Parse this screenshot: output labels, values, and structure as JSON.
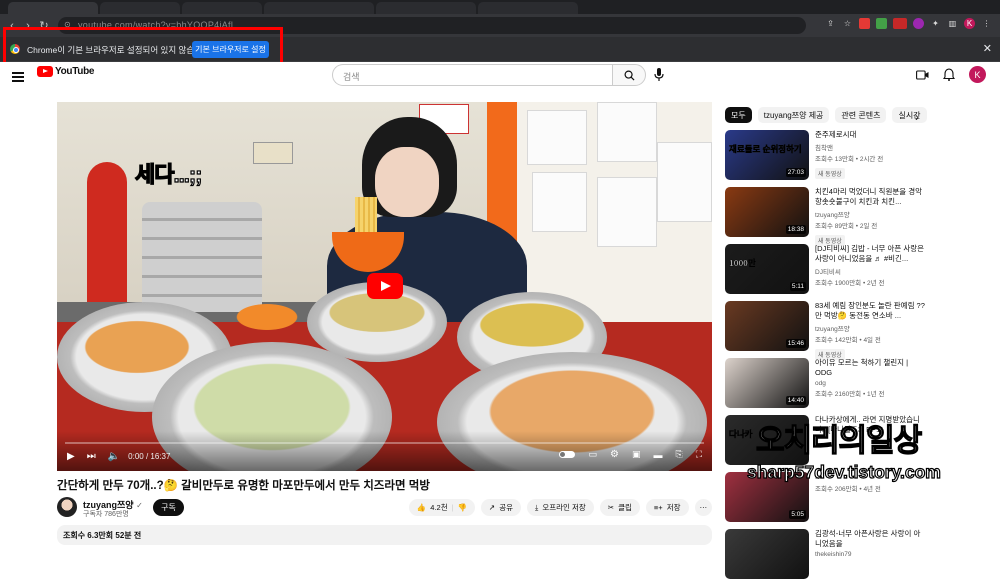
{
  "browser": {
    "url_text": "youtube.com/watch?v=bhYOQP4iAfl",
    "nav_icons": [
      "back-icon",
      "forward-icon",
      "reload-icon"
    ],
    "extension_icons": [
      "puzzle-icon",
      "sidebar-icon"
    ],
    "profile_initial": "K"
  },
  "infobar": {
    "message": "Chrome이 기본 브라우저로 설정되어 있지 않습니다",
    "button_label": "기본 브라우저로 설정",
    "close_glyph": "✕"
  },
  "youtube": {
    "logo_text": "YouTube",
    "search_placeholder": "검색",
    "avatar_initial": "K"
  },
  "player": {
    "overlay_caption": "세다...;;",
    "time_text": "0:00 / 16:37",
    "progress_fraction": 0.0
  },
  "video": {
    "title": "간단하게 만두 70개..?🤔 갈비만두로 유명한 마포만두에서 만두 치즈라면 먹방",
    "channel_name": "tzuyang쯔양",
    "subscribers": "구독자 786만명",
    "subscribe_label": "구독",
    "like_count": "4.2천",
    "share_label": "공유",
    "download_label": "오프라인 저장",
    "clip_label": "클립",
    "save_label": "저장",
    "more_glyph": "⋯",
    "description_stats": "조회수 6.3만회  52분 전"
  },
  "chips": [
    "모두",
    "tzuyang쯔양 제공",
    "관련 콘텐츠",
    "실시간"
  ],
  "recommendations": [
    {
      "title": "준주제로시대",
      "channel": "침착맨",
      "meta": "조회수 13만회 • 2시간 전",
      "badge": "새 동영상",
      "duration": "27:03",
      "thumb_color": "#2a3a8a",
      "thumb_text": "재료들로 순위정하기"
    },
    {
      "title": "치킨4마리 먹었더니 직원분을 경악 항솟숏불구이 치킨과 치킨...",
      "channel": "tzuyang쯔양",
      "meta": "조회수 89만회 • 2일 전",
      "badge": "새 동영상",
      "duration": "18:38",
      "thumb_color": "#8a3a12",
      "thumb_text": ""
    },
    {
      "title": "[DJ티비씨] 김밥 - 너무 아픈 사랑은 사랑이 아니었음을 ♬ #비긴...",
      "channel": "DJ티비씨",
      "meta": "조회수 1900만회 • 2년 전",
      "badge": "",
      "duration": "5:11",
      "thumb_color": "#1c1c1c",
      "thumb_text": "1000만"
    },
    {
      "title": "83세 예림 장인분도 놀란 판예림 ??만 먹방🤔 동전동 연소바 ...",
      "channel": "tzuyang쯔양",
      "meta": "조회수 142만회 • 4일 전",
      "badge": "새 동영상",
      "duration": "15:46",
      "thumb_color": "#6a3a22",
      "thumb_text": ""
    },
    {
      "title": "아이유 모르는 척하기 챌린지 | ODG",
      "channel": "odg",
      "meta": "조회수 2160만회 • 1년 전",
      "badge": "",
      "duration": "14:40",
      "thumb_color": "#ddd3cc",
      "thumb_text": ""
    },
    {
      "title": "다나카상에게.. 라면 지명받았습니다.. [다나길드3] EP11",
      "channel": "",
      "meta": "",
      "badge": "",
      "duration": "",
      "thumb_color": "#2b2b2b",
      "thumb_text": "다나카"
    },
    {
      "title": "...",
      "channel": "",
      "meta": "조회수 206만회 • 4년 전",
      "badge": "",
      "duration": "5:05",
      "thumb_color": "#a03040",
      "thumb_text": ""
    },
    {
      "title": "김광석-너무 아픈사랑은 사랑이 아니었음을",
      "channel": "thekeishin79",
      "meta": "",
      "badge": "",
      "duration": "",
      "thumb_color": "#3a3a3a",
      "thumb_text": ""
    }
  ],
  "watermark": {
    "line1": "오치리의일상",
    "line2": "sharp57dev.tistory.com"
  }
}
